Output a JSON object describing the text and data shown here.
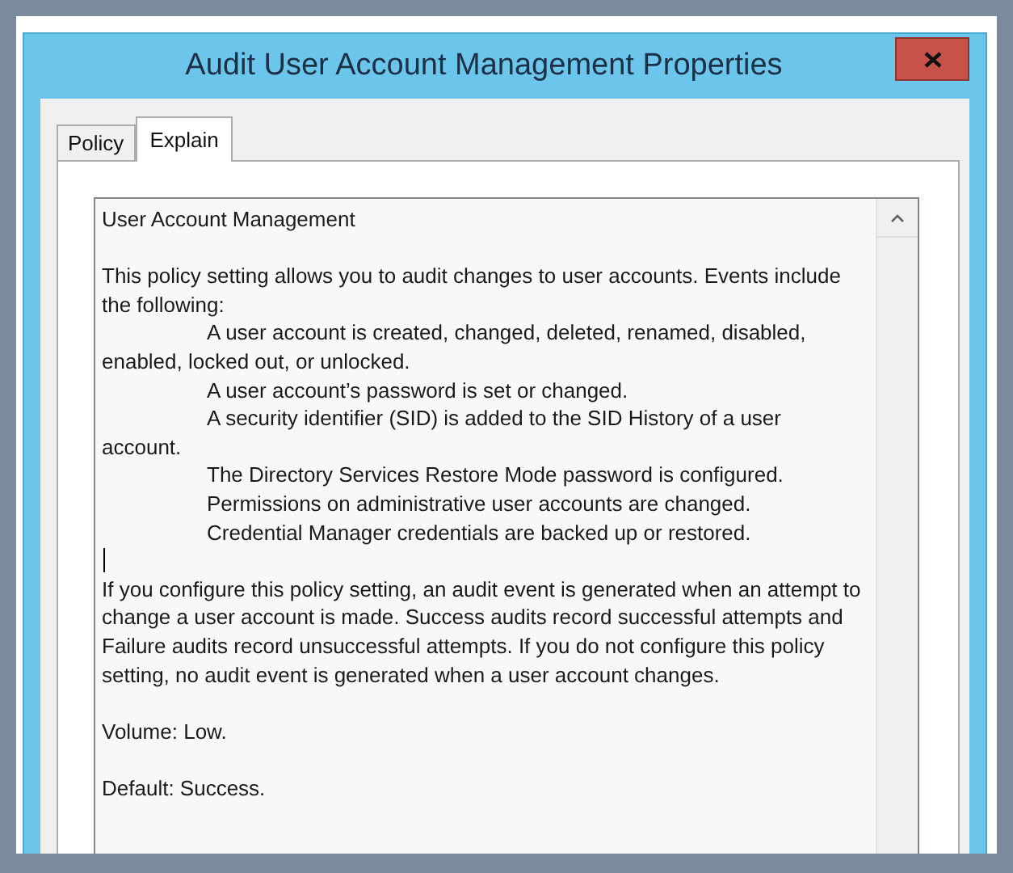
{
  "window": {
    "title": "Audit User Account Management Properties"
  },
  "tabs": [
    {
      "label": "Policy",
      "selected": false
    },
    {
      "label": "Explain",
      "selected": true
    }
  ],
  "explain_text": [
    {
      "kind": "heading",
      "text": "User Account Management"
    },
    {
      "kind": "blank"
    },
    {
      "kind": "paragraph",
      "text": "This policy setting allows you to audit changes to user accounts. Events include the following:"
    },
    {
      "kind": "indented",
      "text": "A user account is created, changed, deleted, renamed, disabled, enabled, locked out, or unlocked."
    },
    {
      "kind": "indented",
      "text": "A user account’s password is set or changed."
    },
    {
      "kind": "indented",
      "text": "A security identifier (SID) is added to the SID History of a user account."
    },
    {
      "kind": "indented",
      "text": "The Directory Services Restore Mode password is configured."
    },
    {
      "kind": "indented",
      "text": "Permissions on administrative user accounts are changed."
    },
    {
      "kind": "indented",
      "text": "Credential Manager credentials are backed up or restored."
    },
    {
      "kind": "cursor"
    },
    {
      "kind": "paragraph",
      "text": "If you configure this policy setting, an audit event is generated when an attempt to change a user account is made. Success audits record successful attempts and Failure audits record unsuccessful attempts. If you do not configure this policy setting, no audit event is generated when a user account changes."
    },
    {
      "kind": "blank"
    },
    {
      "kind": "paragraph",
      "text": "Volume: Low."
    },
    {
      "kind": "blank"
    },
    {
      "kind": "paragraph",
      "text": "Default: Success."
    }
  ]
}
